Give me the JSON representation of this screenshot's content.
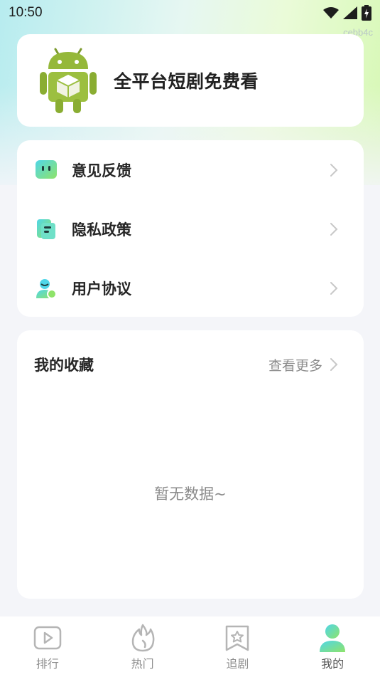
{
  "status_bar": {
    "time": "10:50",
    "icons": [
      "wifi-icon",
      "cell-signal-icon",
      "battery-charging-icon"
    ]
  },
  "watermark": "cebb4c",
  "hero": {
    "title": "全平台短剧免费看",
    "logo": "android-box-logo"
  },
  "menu": {
    "items": [
      {
        "label": "意见反馈",
        "icon": "feedback-icon"
      },
      {
        "label": "隐私政策",
        "icon": "privacy-scroll-icon"
      },
      {
        "label": "用户协议",
        "icon": "user-agreement-icon"
      }
    ]
  },
  "favorites": {
    "title": "我的收藏",
    "more_label": "查看更多",
    "empty_text": "暂无数据~"
  },
  "tabs": [
    {
      "label": "排行",
      "icon": "play-rank-icon",
      "active": false
    },
    {
      "label": "热门",
      "icon": "flame-icon",
      "active": false
    },
    {
      "label": "追剧",
      "icon": "bookmark-star-icon",
      "active": false
    },
    {
      "label": "我的",
      "icon": "person-icon",
      "active": true
    }
  ],
  "colors": {
    "accent_gradient_start": "#4fd6e8",
    "accent_gradient_end": "#8fe36a",
    "tab_inactive": "#b5b5b5"
  }
}
